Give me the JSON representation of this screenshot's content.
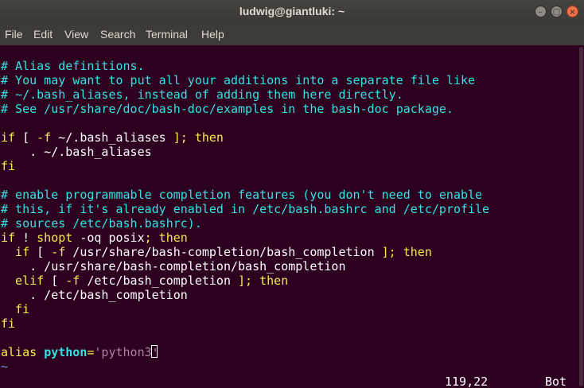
{
  "window": {
    "title": "ludwig@giantluki: ~"
  },
  "window_buttons": {
    "minimize_glyph": "–",
    "maximize_glyph": "□",
    "close_glyph": "×"
  },
  "menu": [
    {
      "label": "File"
    },
    {
      "label": "Edit"
    },
    {
      "label": "View"
    },
    {
      "label": "Search"
    },
    {
      "label": "Terminal"
    },
    {
      "label": "Help"
    }
  ],
  "editor": {
    "lines": [
      [
        {
          "t": "# Alias definitions.",
          "k": "comment"
        }
      ],
      [
        {
          "t": "# You may want to put all your additions into a separate file like",
          "k": "comment"
        }
      ],
      [
        {
          "t": "# ~/.bash_aliases, instead of adding them here directly.",
          "k": "comment"
        }
      ],
      [
        {
          "t": "# See /usr/share/doc/bash-doc/examples in the bash-doc package.",
          "k": "comment"
        }
      ],
      [],
      [
        {
          "t": "if",
          "k": "keyword"
        },
        {
          "t": " [ ",
          "k": "plain"
        },
        {
          "t": "-f",
          "k": "keyword"
        },
        {
          "t": " ~/.bash_aliases ",
          "k": "plain"
        },
        {
          "t": "];",
          "k": "keyword"
        },
        {
          "t": " then",
          "k": "keyword"
        }
      ],
      [
        {
          "t": "    . ~/.bash_aliases",
          "k": "plain"
        }
      ],
      [
        {
          "t": "fi",
          "k": "keyword"
        }
      ],
      [],
      [
        {
          "t": "# enable programmable completion features (you don't need to enable",
          "k": "comment"
        }
      ],
      [
        {
          "t": "# this, if it's already enabled in /etc/bash.bashrc and /etc/profile",
          "k": "comment"
        }
      ],
      [
        {
          "t": "# sources /etc/bash.bashrc).",
          "k": "comment"
        }
      ],
      [
        {
          "t": "if",
          "k": "keyword"
        },
        {
          "t": " ! ",
          "k": "plain"
        },
        {
          "t": "shopt",
          "k": "keyword"
        },
        {
          "t": " -oq posix",
          "k": "plain"
        },
        {
          "t": ";",
          "k": "keyword"
        },
        {
          "t": " then",
          "k": "keyword"
        }
      ],
      [
        {
          "t": "  if",
          "k": "keyword"
        },
        {
          "t": " [ ",
          "k": "plain"
        },
        {
          "t": "-f",
          "k": "keyword"
        },
        {
          "t": " /usr/share/bash-completion/bash_completion ",
          "k": "plain"
        },
        {
          "t": "];",
          "k": "keyword"
        },
        {
          "t": " then",
          "k": "keyword"
        }
      ],
      [
        {
          "t": "    . /usr/share/bash-completion/bash_completion",
          "k": "plain"
        }
      ],
      [
        {
          "t": "  elif",
          "k": "keyword"
        },
        {
          "t": " [ ",
          "k": "plain"
        },
        {
          "t": "-f",
          "k": "keyword"
        },
        {
          "t": " /etc/bash_completion ",
          "k": "plain"
        },
        {
          "t": "];",
          "k": "keyword"
        },
        {
          "t": " then",
          "k": "keyword"
        }
      ],
      [
        {
          "t": "    . /etc/bash_completion",
          "k": "plain"
        }
      ],
      [
        {
          "t": "  fi",
          "k": "keyword"
        }
      ],
      [
        {
          "t": "fi",
          "k": "keyword"
        }
      ],
      [],
      [
        {
          "t": "alias ",
          "k": "keyword"
        },
        {
          "t": "python",
          "k": "ident"
        },
        {
          "t": "=",
          "k": "keyword"
        },
        {
          "t": "'python3",
          "k": "string"
        },
        {
          "t": "'",
          "k": "cursor"
        }
      ],
      [
        {
          "t": "~",
          "k": "tilde"
        }
      ]
    ],
    "colors": {
      "background": "#2c001e",
      "comment": "#34e2e2",
      "keyword": "#fce94f",
      "plain": "#ffffff",
      "ident": "#34e2e2",
      "string": "#ad7fa8",
      "tilde": "#729fcf"
    }
  },
  "statusline": {
    "position": "119,22",
    "scroll": "Bot"
  }
}
